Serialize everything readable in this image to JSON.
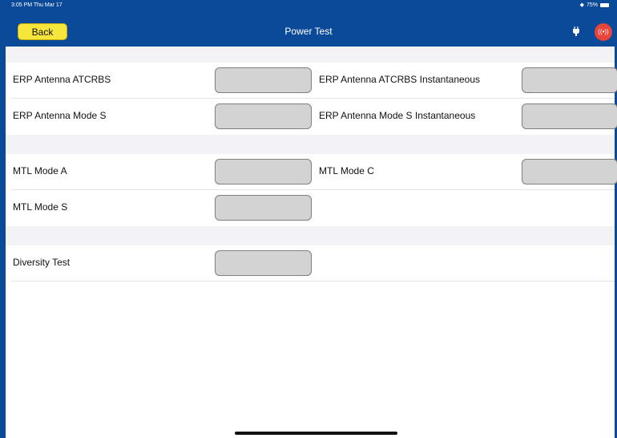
{
  "status_bar": {
    "time": "3:05 PM  Thu Mar 17",
    "battery": "75%"
  },
  "header": {
    "back_label": "Back",
    "title": "Power Test",
    "signal_symbol": "((•))"
  },
  "sections": [
    {
      "rows": [
        {
          "label": "ERP Antenna ATCRBS",
          "value": "",
          "label2": "ERP Antenna ATCRBS Instantaneous",
          "value2": ""
        },
        {
          "label": "ERP Antenna Mode S",
          "value": "",
          "label2": "ERP Antenna Mode S Instantaneous",
          "value2": ""
        }
      ]
    },
    {
      "rows": [
        {
          "label": "MTL Mode A",
          "value": "",
          "label2": "MTL Mode C",
          "value2": ""
        },
        {
          "label": "MTL Mode S",
          "value": ""
        }
      ]
    },
    {
      "rows": [
        {
          "label": "Diversity Test",
          "value": ""
        }
      ]
    }
  ],
  "colors": {
    "header_bg": "#0b4a99",
    "back_button": "#f6e53b",
    "signal_button": "#e7453a",
    "field_bg": "#d3d3d3",
    "gap_bg": "#f2f2f7"
  },
  "icons": [
    "wifi-icon",
    "battery-icon",
    "plug-icon",
    "signal-icon"
  ]
}
